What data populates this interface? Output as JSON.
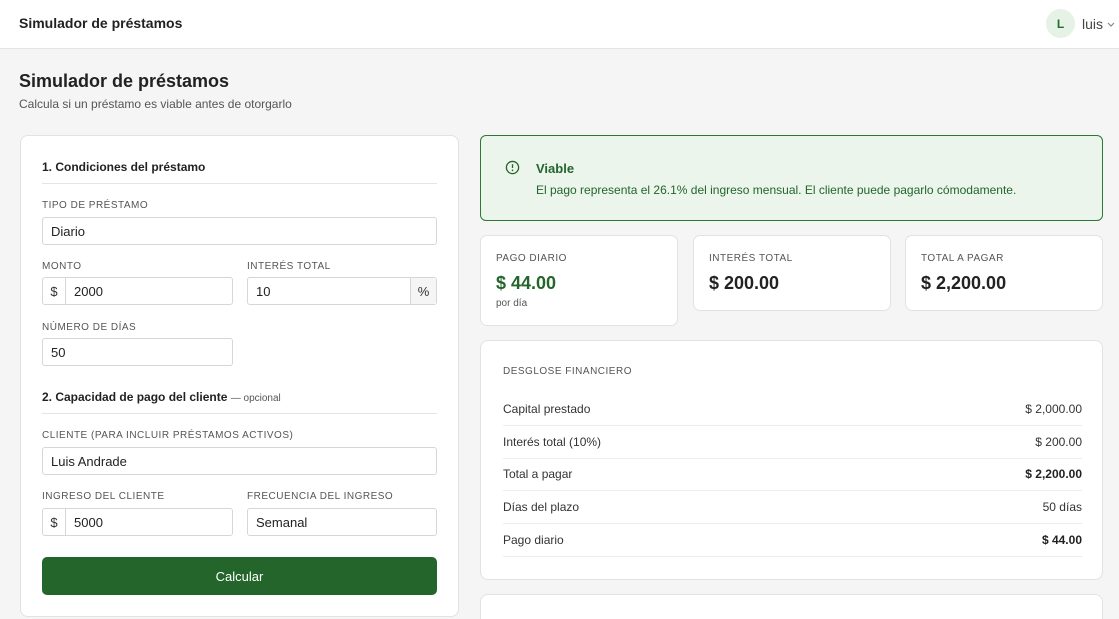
{
  "header": {
    "title": "Simulador de préstamos",
    "user_initial": "L",
    "user_name": "luis"
  },
  "page": {
    "title": "Simulador de préstamos",
    "subtitle": "Calcula si un préstamo es viable antes de otorgarlo"
  },
  "form": {
    "section1_title": "1. Condiciones del préstamo",
    "loan_type_label": "TIPO DE PRÉSTAMO",
    "loan_type_value": "Diario",
    "amount_label": "MONTO",
    "amount_prefix": "$",
    "amount_value": "2000",
    "interest_label": "INTERÉS TOTAL",
    "interest_value": "10",
    "interest_suffix": "%",
    "days_label": "NÚMERO DE DÍAS",
    "days_value": "50",
    "section2_title": "2. Capacidad de pago del cliente",
    "section2_optional": "— opcional",
    "client_label": "CLIENTE (PARA INCLUIR PRÉSTAMOS ACTIVOS)",
    "client_value": "Luis Andrade",
    "income_label": "INGRESO DEL CLIENTE",
    "income_prefix": "$",
    "income_value": "5000",
    "frequency_label": "FRECUENCIA DEL INGRESO",
    "frequency_value": "Semanal",
    "submit_label": "Calcular"
  },
  "alert": {
    "title": "Viable",
    "text": "El pago representa el 26.1% del ingreso mensual. El cliente puede pagarlo cómodamente.",
    "color": "#23652b",
    "icon": "info-circle-icon"
  },
  "stats": [
    {
      "label": "PAGO DIARIO",
      "value": "$ 44.00",
      "sub": "por día"
    },
    {
      "label": "INTERÉS TOTAL",
      "value": "$ 200.00"
    },
    {
      "label": "TOTAL A PAGAR",
      "value": "$ 2,200.00"
    }
  ],
  "breakdown": {
    "title": "DESGLOSE FINANCIERO",
    "rows": [
      {
        "label": "Capital prestado",
        "value": "$ 2,000.00"
      },
      {
        "label": "Interés total (10%)",
        "value": "$ 200.00"
      },
      {
        "label": "Total a pagar",
        "value": "$ 2,200.00"
      },
      {
        "label": "Días del plazo",
        "value": "50 días"
      },
      {
        "label": "Pago diario",
        "value": "$ 44.00"
      }
    ]
  }
}
